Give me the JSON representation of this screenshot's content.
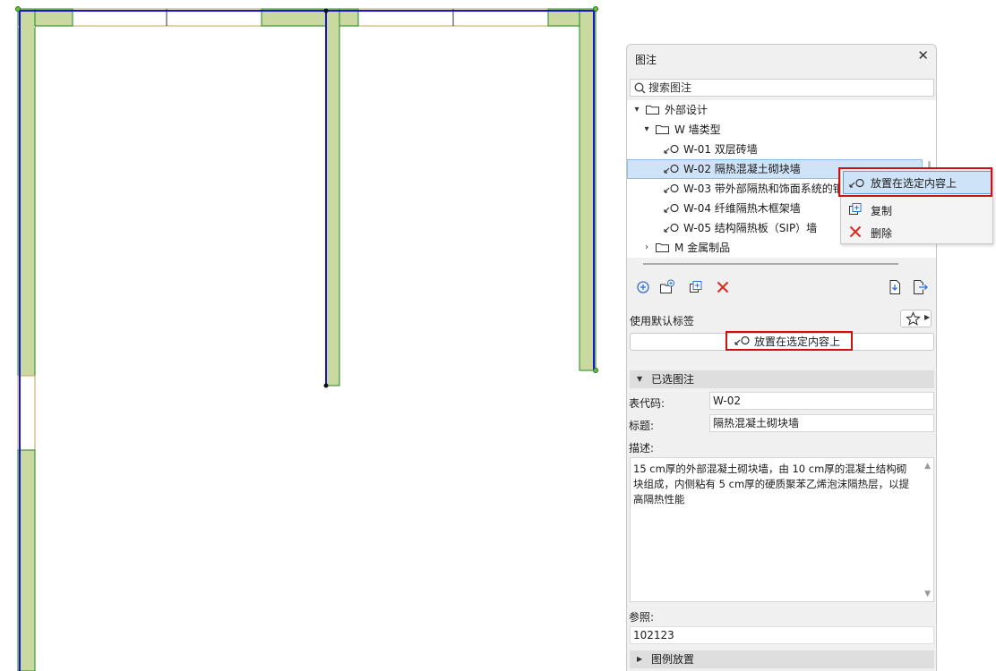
{
  "palette": {
    "title": "图注",
    "close": "✕",
    "search": {
      "placeholder": "搜索图注"
    },
    "tree": {
      "folders": [
        {
          "label": "外部设计"
        },
        {
          "label": "W 墙类型"
        },
        {
          "label": "M 金属制品"
        }
      ],
      "items": [
        {
          "label": "W-01 双层砖墙"
        },
        {
          "label": "W-02 隔热混凝土砌块墙"
        },
        {
          "label": "W-03 带外部隔热和饰面系统的钢"
        },
        {
          "label": "W-04 纤维隔热木框架墙"
        },
        {
          "label": "W-05 结构隔热板（SIP）墙"
        }
      ]
    },
    "toolbar_icons": [
      "add-circle-icon",
      "new-folder-icon",
      "duplicate-icon",
      "delete-icon",
      "import-icon",
      "export-icon"
    ],
    "default_label": "使用默认标签",
    "place_button": "放置在选定内容上",
    "selected_section": "已选图注",
    "fields": {
      "code_label": "表代码:",
      "code_value": "W-02",
      "title_label": "标题:",
      "title_value": "隔热混凝土砌块墙",
      "desc_label": "描述:",
      "desc_value": "15 cm厚的外部混凝土砌块墙，由 10 cm厚的混凝土结构砌块组成，内侧粘有 5 cm厚的硬质聚苯乙烯泡沫隔热层，以提高隔热性能",
      "ref_label": "参照:",
      "ref_value": "102123"
    },
    "legend_section": "图例放置"
  },
  "context_menu": {
    "place": "放置在选定内容上",
    "copy": "复制",
    "delete": "删除"
  },
  "colors": {
    "wall_fill": "#c9d9a0",
    "wall_stroke": "#1f8a1f",
    "ref_line": "#1414d2",
    "highlight_red": "#d10f0f",
    "selection_blue": "#cfe3f8"
  }
}
